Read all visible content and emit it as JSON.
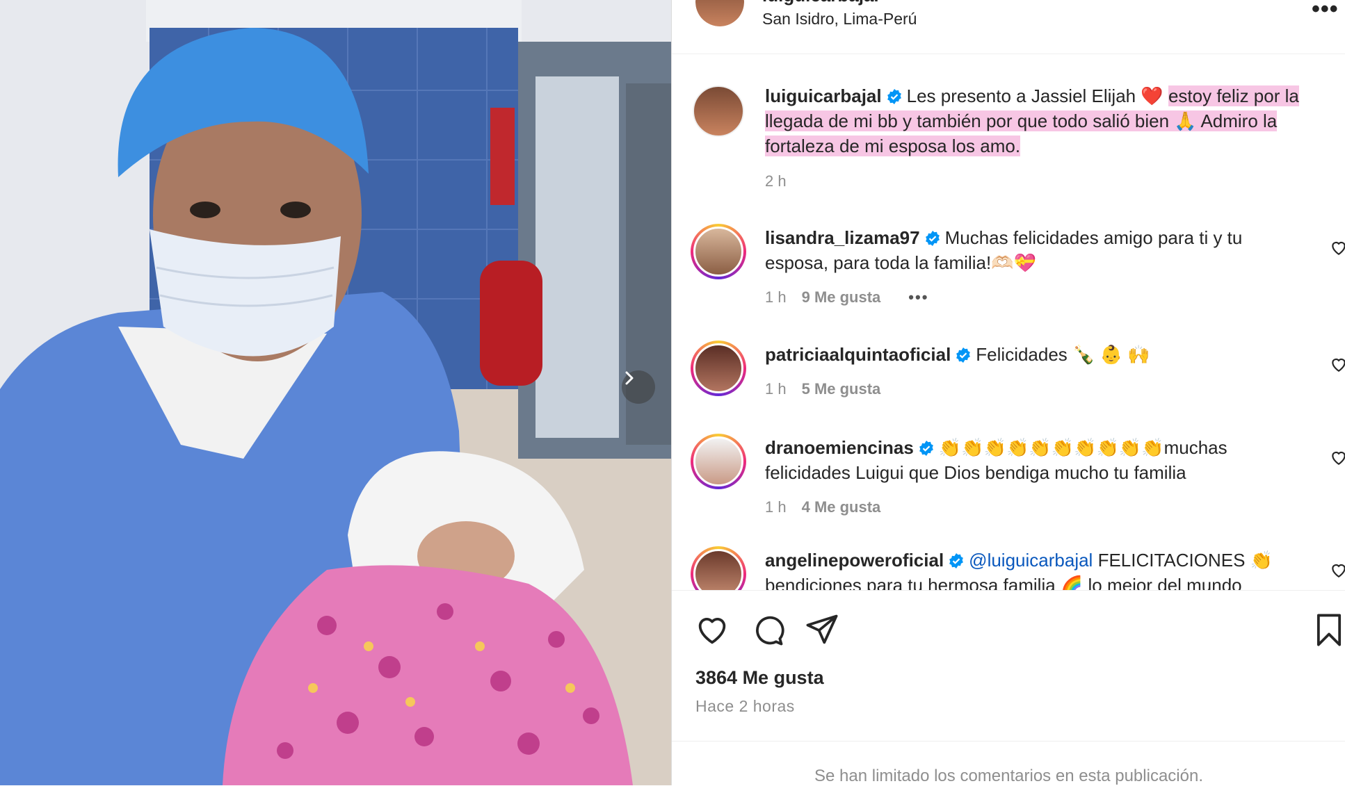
{
  "post": {
    "author": "luiguicarbajal",
    "location": "San Isidro, Lima-Perú",
    "caption_plain": "Les presento a Jassiel Elijah ❤️",
    "caption_highlight_1": "estoy feliz por la",
    "caption_highlight_2": "llegada de mi bb y también por que todo salió bien 🙏 Admiro la",
    "caption_highlight_3": "fortaleza de mi esposa los amo.",
    "time": "2 h",
    "likes": "3864 Me gusta",
    "posted_ago": "Hace 2 horas",
    "comments_limited": "Se han limitado los comentarios en esta publicación."
  },
  "comments": [
    {
      "user": "lisandra_lizama97",
      "text_1": "Muchas felicidades amigo para ti y tu",
      "text_2": "esposa, para toda la familia!🫶🏻💝",
      "time": "1 h",
      "likes": "9 Me gusta",
      "more": "•••"
    },
    {
      "user": "patriciaalquintaoficial",
      "text_1": "Felicidades 🍾 👶 🙌",
      "time": "1 h",
      "likes": "5 Me gusta"
    },
    {
      "user": "dranoemiencinas",
      "text_1": "👏👏👏👏👏👏👏👏👏👏muchas",
      "text_2": "felicidades Luigui que Dios bendiga mucho tu familia",
      "time": "1 h",
      "likes": "4 Me gusta"
    },
    {
      "user": "angelinepoweroficial",
      "mention": "@luiguicarbajal",
      "text_1": "FELICITACIONES 👏",
      "text_2": "bendiciones para tu hermosa familia 🌈 lo mejor del mundo"
    }
  ],
  "icons": {
    "verified": "verified-badge-icon",
    "like": "heart-icon",
    "comment": "comment-bubble-icon",
    "share": "paper-plane-icon",
    "save": "bookmark-icon",
    "next": "chevron-right-icon",
    "more": "more-options-icon"
  },
  "colors": {
    "verified": "#0095f6",
    "highlight": "#f7c6e4",
    "mention": "#0a58bd",
    "muted": "#8e8e8e"
  }
}
